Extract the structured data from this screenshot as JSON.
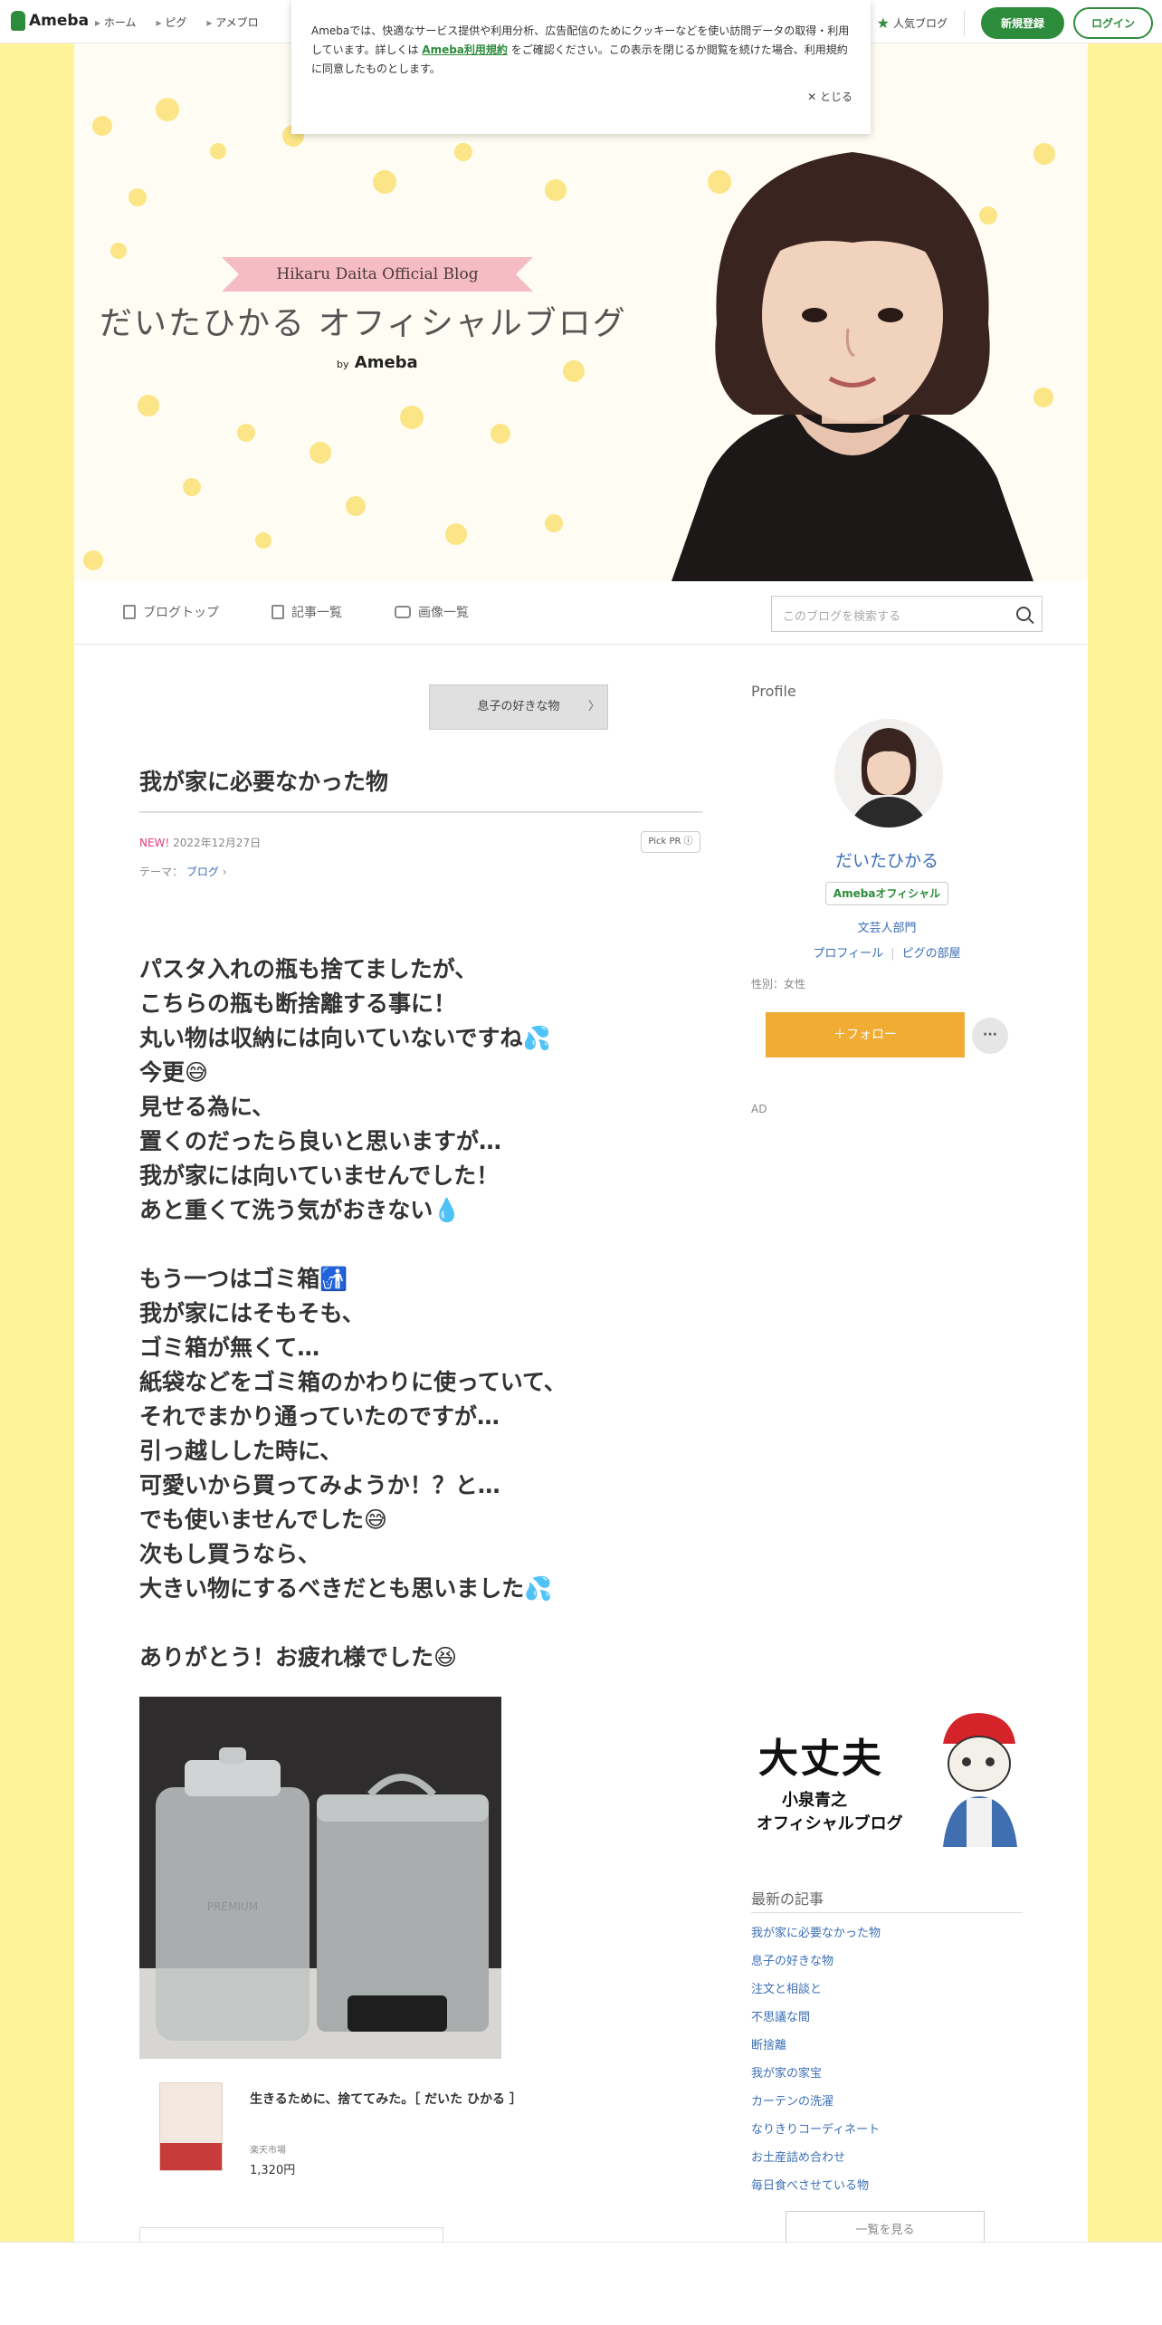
{
  "header": {
    "logo": "Ameba",
    "nav": [
      "ホーム",
      "ピグ",
      "アメブロ"
    ],
    "popular": "人気ブログ",
    "register": "新規登録",
    "login": "ログイン"
  },
  "cookie": {
    "text_before": "Amebaでは、快適なサービス提供や利用分析、広告配信のためにクッキーなどを使い訪問データの取得・利用しています。詳しくは",
    "link": "Ameba利用規約",
    "text_after": "をご確認ください。この表示を閉じるか閲覧を続けた場合、利用規約に同意したものとします。",
    "close": "とじる"
  },
  "banner": {
    "ribbon": "Hikaru Daita Official Blog",
    "title": "だいたひかる オフィシャルブログ",
    "by": "by",
    "ameba": "Ameba"
  },
  "blognav": {
    "top": "ブログトップ",
    "list": "記事一覧",
    "images": "画像一覧",
    "search_placeholder": "このブログを検索する"
  },
  "article": {
    "prev": "息子の好きな物",
    "title": "我が家に必要なかった物",
    "new": "NEW!",
    "date": "2022年12月27日",
    "pickpr": "Pick PR ⓘ",
    "theme_label": "テーマ：",
    "theme": "ブログ",
    "lines": [
      "パスタ入れの瓶も捨てましたが、",
      "こちらの瓶も断捨離する事に！",
      "丸い物は収納には向いていないですね💦",
      "今更😅",
      "見せる為に、",
      "置くのだったら良いと思いますが…",
      "我が家には向いていませんでした！",
      "あと重くて洗う気がおきない💧",
      "",
      "もう一つはゴミ箱🚮",
      "我が家にはそもそも、",
      "ゴミ箱が無くて…",
      "紙袋などをゴミ箱のかわりに使っていて、",
      "それでまかり通っていたのですが…",
      "引っ越しした時に、",
      "可愛いから買ってみようか！？と…",
      "でも使いませんでした😅",
      "次もし買うなら、",
      "大きい物にするべきだとも思いました💦",
      "",
      "ありがとう！お疲れ様でした😆"
    ],
    "photo_label": "PREMIUM",
    "product": {
      "title": "生きるために、捨ててみた。［ だいた ひかる ］",
      "shop": "楽天市場",
      "price": "1,320円"
    }
  },
  "sidebar": {
    "profile_heading": "Profile",
    "name": "だいたひかる",
    "badge": "Amebaオフィシャル",
    "category": "文芸人部門",
    "link1": "プロフィール",
    "link2": "ピグの部屋",
    "gender": "性別：女性",
    "follow": "＋フォロー",
    "more": "···",
    "ad": "AD",
    "ad_banner": {
      "line1": "大丈夫",
      "line2": "小泉青之",
      "line3": "オフィシャルブログ"
    },
    "recent_heading": "最新の記事",
    "recent": [
      "我が家に必要なかった物",
      "息子の好きな物",
      "注文と相談と",
      "不思議な間",
      "断捨離",
      "我が家の家宝",
      "カーテンの洗濯",
      "なりきりコーディネート",
      "お土産詰め合わせ",
      "毎日食べさせている物"
    ],
    "see_all": "一覧を見る"
  },
  "colors": {
    "brand_green": "#2d8c3c",
    "follow_orange": "#f1ac33",
    "link_blue": "#3b6fb6",
    "background_yellow": "#fff39a"
  }
}
